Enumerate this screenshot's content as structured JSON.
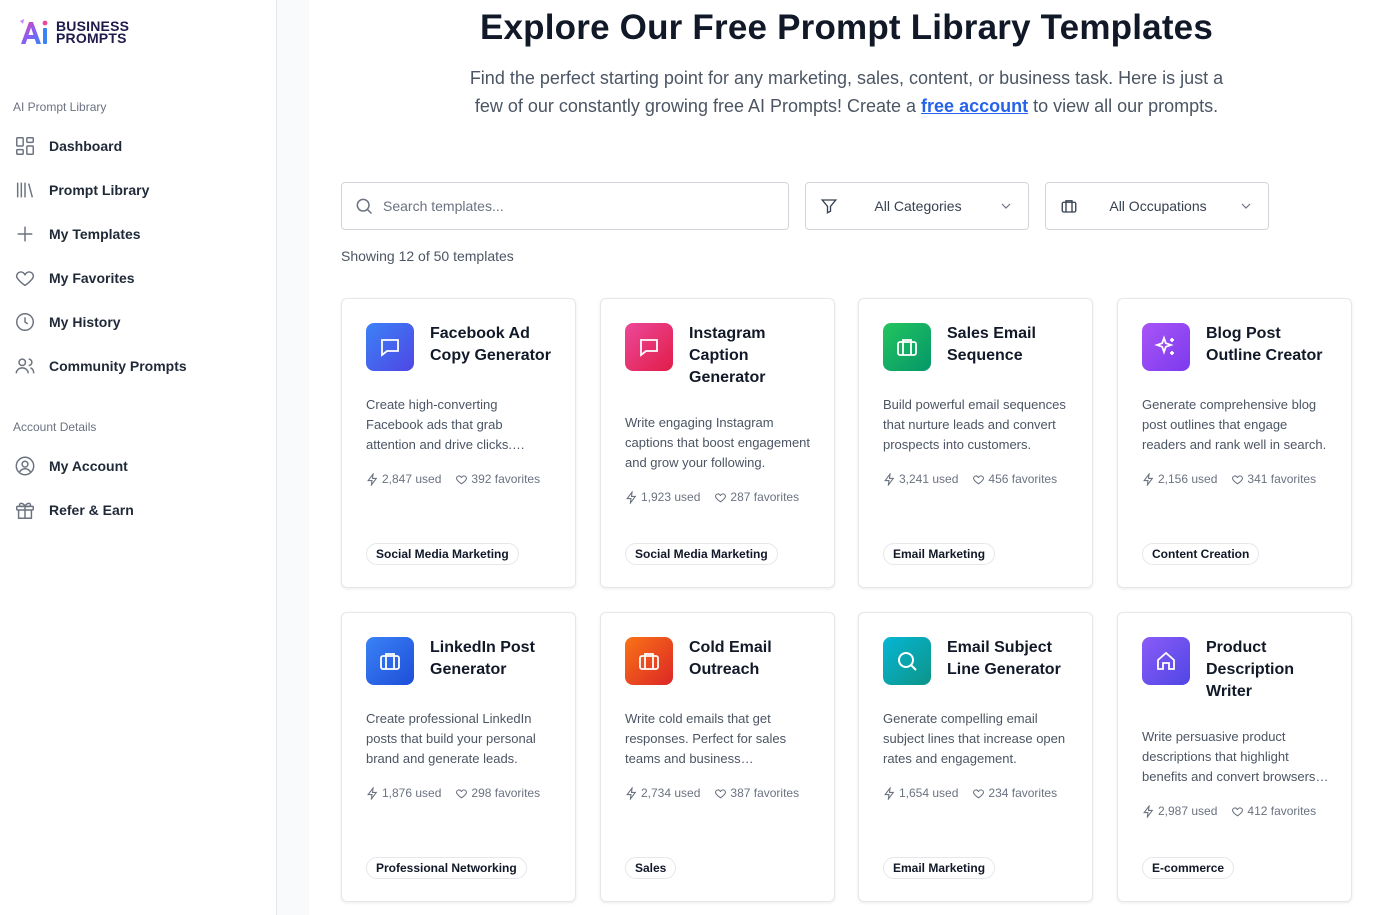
{
  "brand": {
    "line1": "BUSINESS",
    "line2": "PROMPTS"
  },
  "sidebar": {
    "section1": "AI Prompt Library",
    "items1": [
      {
        "label": "Dashboard",
        "icon": "dashboard-icon"
      },
      {
        "label": "Prompt Library",
        "icon": "library-icon"
      },
      {
        "label": "My Templates",
        "icon": "plus-icon"
      },
      {
        "label": "My Favorites",
        "icon": "heart-icon"
      },
      {
        "label": "My History",
        "icon": "clock-icon"
      },
      {
        "label": "Community Prompts",
        "icon": "users-icon"
      }
    ],
    "section2": "Account Details",
    "items2": [
      {
        "label": "My Account",
        "icon": "user-circle-icon"
      },
      {
        "label": "Refer & Earn",
        "icon": "gift-icon"
      }
    ]
  },
  "header": {
    "title": "Explore Our Free Prompt Library Templates",
    "subtitle_before": "Find the perfect starting point for any marketing, sales, content, or business task. Here is just a few of our constantly growing free AI Prompts! Create a ",
    "subtitle_link": "free account",
    "subtitle_after": " to view all our prompts."
  },
  "filters": {
    "search_placeholder": "Search templates...",
    "category": "All Categories",
    "occupation": "All Occupations"
  },
  "count_text": "Showing 12 of 50 templates",
  "colors": {
    "blue": "#3b82f6",
    "pink": "#ec4899",
    "green": "#10b981",
    "purple": "#a855f7",
    "orange": "#f97316",
    "teal": "#06b6d4"
  },
  "cards": [
    {
      "title": "Facebook Ad Copy Generator",
      "desc": "Create high-converting Facebook ads that grab attention and drive clicks. Perfect for campaigns.",
      "used": "2,847 used",
      "favorites": "392 favorites",
      "tag": "Social Media Marketing",
      "icon": "message-icon"
    },
    {
      "title": "Instagram Caption Generator",
      "desc": "Write engaging Instagram captions that boost engagement and grow your following.",
      "used": "1,923 used",
      "favorites": "287 favorites",
      "tag": "Social Media Marketing",
      "icon": "message-icon"
    },
    {
      "title": "Sales Email Sequence",
      "desc": "Build powerful email sequences that nurture leads and convert prospects into customers.",
      "used": "3,241 used",
      "favorites": "456 favorites",
      "tag": "Email Marketing",
      "icon": "briefcase-icon"
    },
    {
      "title": "Blog Post Outline Creator",
      "desc": "Generate comprehensive blog post outlines that engage readers and rank well in search.",
      "used": "2,156 used",
      "favorites": "341 favorites",
      "tag": "Content Creation",
      "icon": "sparkle-icon"
    },
    {
      "title": "LinkedIn Post Generator",
      "desc": "Create professional LinkedIn posts that build your personal brand and generate leads.",
      "used": "1,876 used",
      "favorites": "298 favorites",
      "tag": "Professional Networking",
      "icon": "briefcase-icon"
    },
    {
      "title": "Cold Email Outreach",
      "desc": "Write cold emails that get responses. Perfect for sales teams and business development.",
      "used": "2,734 used",
      "favorites": "387 favorites",
      "tag": "Sales",
      "icon": "briefcase-icon"
    },
    {
      "title": "Email Subject Line Generator",
      "desc": "Generate compelling email subject lines that increase open rates and engagement.",
      "used": "1,654 used",
      "favorites": "234 favorites",
      "tag": "Email Marketing",
      "icon": "search-icon"
    },
    {
      "title": "Product Description Writer",
      "desc": "Write persuasive product descriptions that highlight benefits and convert browsers into buyers.",
      "used": "2,987 used",
      "favorites": "412 favorites",
      "tag": "E-commerce",
      "icon": "home-icon"
    }
  ]
}
